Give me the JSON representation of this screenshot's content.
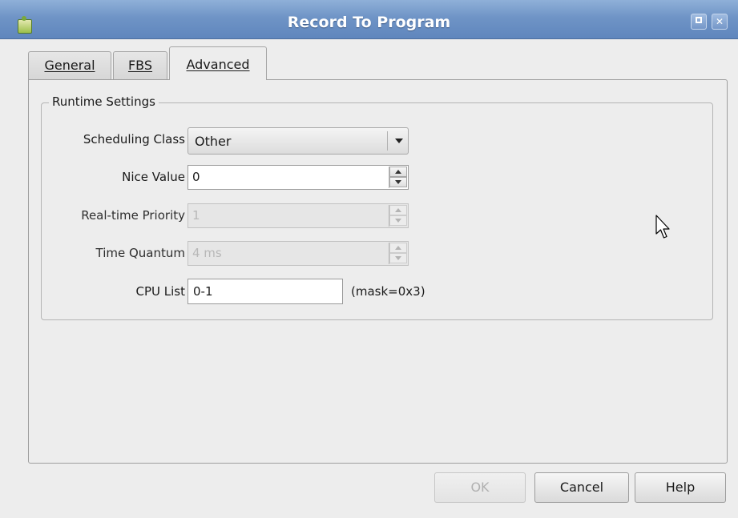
{
  "window": {
    "title": "Record To Program",
    "icon": "app-icon",
    "controls": [
      "maximize-icon",
      "close-icon"
    ],
    "close_glyph": "✕"
  },
  "tabs": [
    {
      "label": "General",
      "active": false
    },
    {
      "label": "FBS",
      "active": false
    },
    {
      "label": "Advanced",
      "active": true
    }
  ],
  "runtime": {
    "legend": "Runtime Settings",
    "scheduling_class": {
      "label": "Scheduling Class",
      "value": "Other"
    },
    "nice_value": {
      "label": "Nice Value",
      "value": "0"
    },
    "realtime_priority": {
      "label": "Real-time Priority",
      "value": "1",
      "enabled": false
    },
    "time_quantum": {
      "label": "Time Quantum",
      "value": "4 ms",
      "enabled": false
    },
    "cpu_list": {
      "label": "CPU List",
      "value": "0-1",
      "mask": "(mask=0x3)"
    }
  },
  "buttons": {
    "ok": {
      "label": "OK",
      "enabled": false
    },
    "cancel": {
      "label": "Cancel"
    },
    "help": {
      "label": "Help"
    }
  },
  "colors": {
    "titlebar": "#6f94c6",
    "dialog_bg": "#ededed"
  }
}
